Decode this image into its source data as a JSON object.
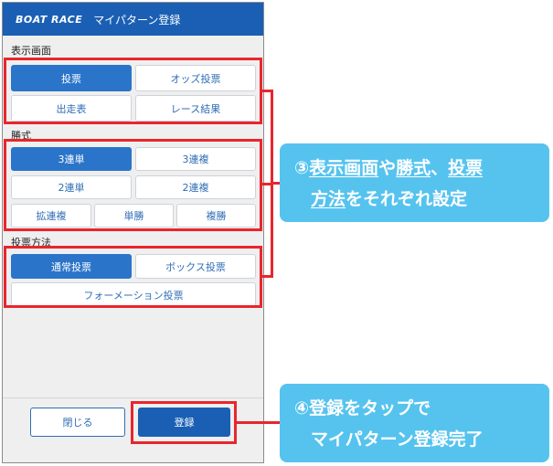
{
  "header": {
    "logo": "BOAT RACE",
    "title": "マイパターン登録"
  },
  "sections": {
    "display": {
      "label": "表示画面",
      "buttons": [
        "投票",
        "オッズ投票",
        "出走表",
        "レース結果"
      ]
    },
    "bet_type": {
      "label": "勝式",
      "buttons": [
        "3連単",
        "3連複",
        "2連単",
        "2連複",
        "拡連複",
        "単勝",
        "複勝"
      ]
    },
    "method": {
      "label": "投票方法",
      "buttons": [
        "通常投票",
        "ボックス投票",
        "フォーメーション投票"
      ]
    }
  },
  "footer": {
    "close_label": "閉じる",
    "register_label": "登録"
  },
  "callouts": {
    "c1": {
      "marker": "③",
      "p1": "表示画面",
      "p2": "や",
      "p3": "勝式",
      "p4": "、",
      "p5": "投票",
      "p6": "方法",
      "p7": "をそれぞれ設定"
    },
    "c2": {
      "line1": "④登録をタップで",
      "line2": "マイパターン登録完了"
    }
  },
  "colors": {
    "header": "#1a5fb4",
    "selected": "#2a74c9",
    "highlight": "#e8262d",
    "callout": "#56c3ef"
  }
}
